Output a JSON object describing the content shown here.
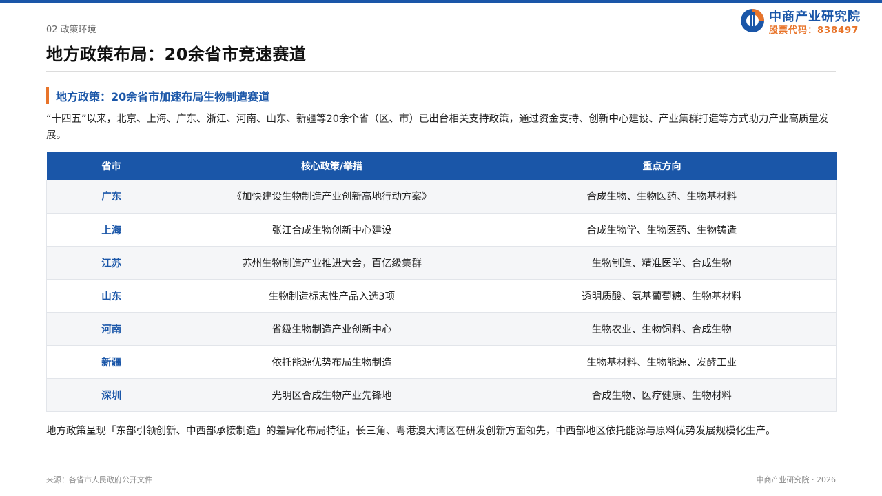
{
  "header": {
    "section_label": "02 政策环境",
    "title": "地方政策布局：20余省市竞速赛道"
  },
  "logo": {
    "icon": "zhongshang-logo-icon",
    "name": "中商产业研究院",
    "stock_code": "股票代码：838497",
    "colors": {
      "blue": "#1a56a8",
      "orange": "#e8742a"
    }
  },
  "subheading": "地方政策：20余省市加速布局生物制造赛道",
  "intro": "“十四五”以来，北京、上海、广东、浙江、河南、山东、新疆等20余个省（区、市）已出台相关支持政策，通过资金支持、创新中心建设、产业集群打造等方式助力产业高质量发展。",
  "table": {
    "headers": [
      "省市",
      "核心政策/举措",
      "重点方向"
    ],
    "rows": [
      {
        "province": "广东",
        "policy": "《加快建设生物制造产业创新高地行动方案》",
        "focus": "合成生物、生物医药、生物基材料"
      },
      {
        "province": "上海",
        "policy": "张江合成生物创新中心建设",
        "focus": "合成生物学、生物医药、生物铸造"
      },
      {
        "province": "江苏",
        "policy": "苏州生物制造产业推进大会，百亿级集群",
        "focus": "生物制造、精准医学、合成生物"
      },
      {
        "province": "山东",
        "policy": "生物制造标志性产品入选3项",
        "focus": "透明质酸、氨基葡萄糖、生物基材料"
      },
      {
        "province": "河南",
        "policy": "省级生物制造产业创新中心",
        "focus": "生物农业、生物饲料、合成生物"
      },
      {
        "province": "新疆",
        "policy": "依托能源优势布局生物制造",
        "focus": "生物基材料、生物能源、发酵工业"
      },
      {
        "province": "深圳",
        "policy": "光明区合成生物产业先锋地",
        "focus": "合成生物、医疗健康、生物材料"
      }
    ]
  },
  "summary": "地方政策呈现「东部引领创新、中西部承接制造」的差异化布局特征，长三角、粤港澳大湾区在研发创新方面领先，中西部地区依托能源与原料优势发展规模化生产。",
  "footer": {
    "source": "来源：各省市人民政府公开文件",
    "brand": "中商产业研究院 · 2026"
  },
  "colors": {
    "accent_blue": "#1a56a8",
    "accent_orange": "#e8742a"
  }
}
